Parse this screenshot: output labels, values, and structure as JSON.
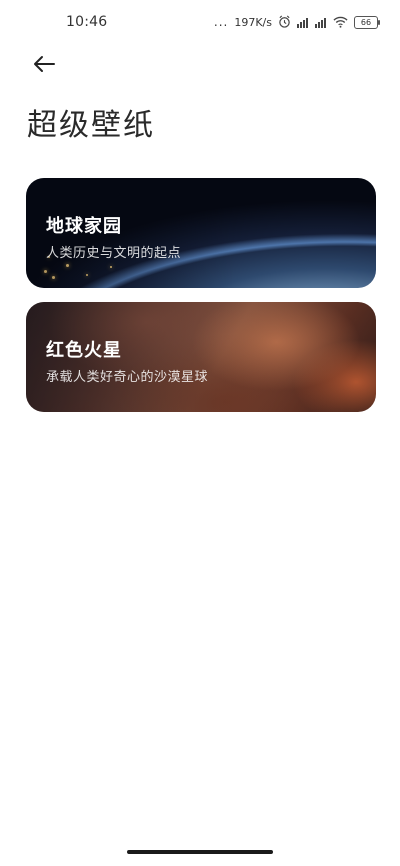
{
  "status_bar": {
    "time": "10:46",
    "dots": "...",
    "network_speed": "197K/s",
    "battery_level": "66",
    "icons": [
      "alarm-icon",
      "signal-icon",
      "signal-icon-2",
      "wifi-icon",
      "battery-icon"
    ]
  },
  "header": {
    "back_icon": "arrow-left-icon",
    "title": "超级壁纸"
  },
  "wallpapers": [
    {
      "title": "地球家园",
      "subtitle": "人类历史与文明的起点"
    },
    {
      "title": "红色火星",
      "subtitle": "承载人类好奇心的沙漠星球"
    }
  ]
}
